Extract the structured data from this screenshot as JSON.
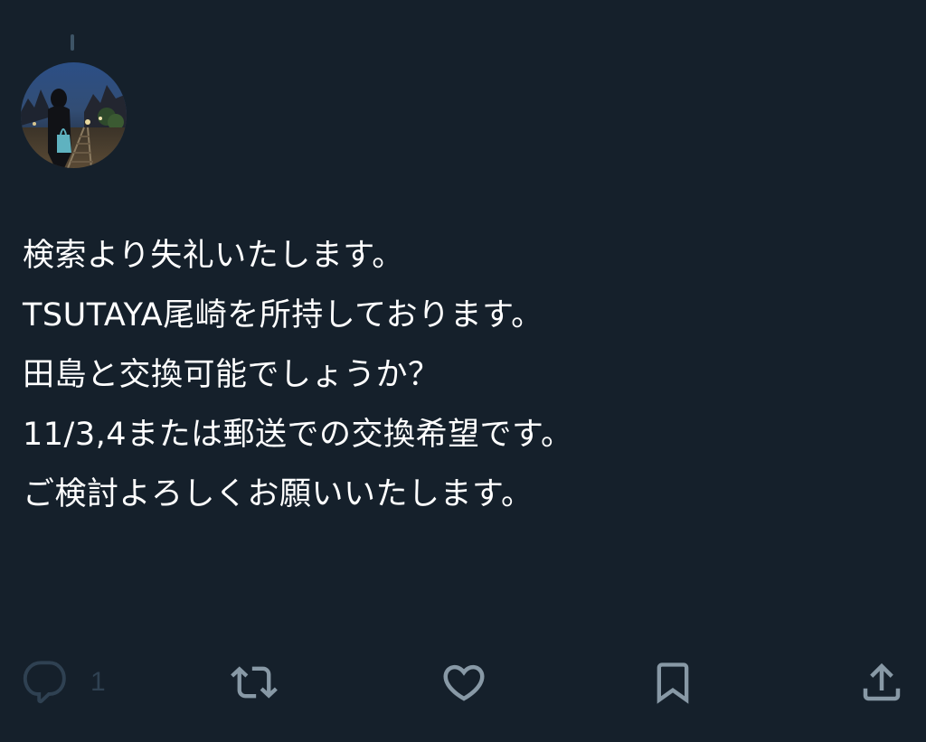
{
  "tweet": {
    "lines": [
      "検索より失礼いたします。",
      "TSUTAYA尾崎を所持しております。",
      "田島と交換可能でしょうか？",
      "11/3,4または郵送での交換希望です。",
      "ご検討よろしくお願いいたします。"
    ]
  },
  "actions": {
    "reply_icon": "reply-icon",
    "reply_count": "1",
    "retweet_icon": "retweet-icon",
    "like_icon": "heart-icon",
    "bookmark_icon": "bookmark-icon",
    "share_icon": "share-icon"
  },
  "colors": {
    "background": "#15202b",
    "text": "#ffffff",
    "icon": "#8899a6",
    "icon_dim": "#2f4152"
  }
}
